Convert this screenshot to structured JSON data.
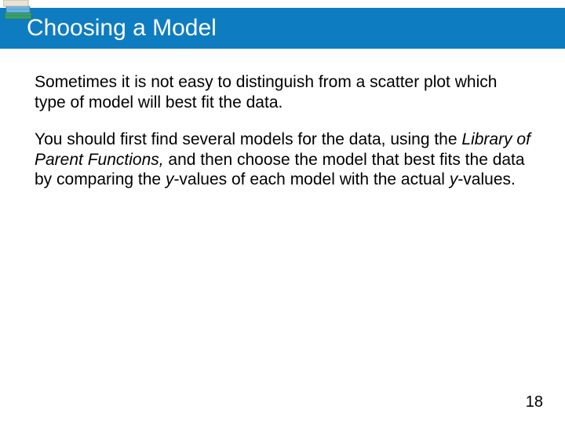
{
  "header": {
    "title": "Choosing a Model",
    "icon": "books-icon"
  },
  "body": {
    "p1": "Sometimes it is not easy to distinguish from a scatter plot which type of model will best fit the data.",
    "p2a": "You should first find several models for the data, using the ",
    "p2_italic": "Library of Parent Functions,",
    "p2b": " and then choose the model that best fits the data by comparing the ",
    "p2_italic2": "y",
    "p2c": "-values of each model with the actual ",
    "p2_italic3": "y",
    "p2d": "-values."
  },
  "page_number": "18"
}
